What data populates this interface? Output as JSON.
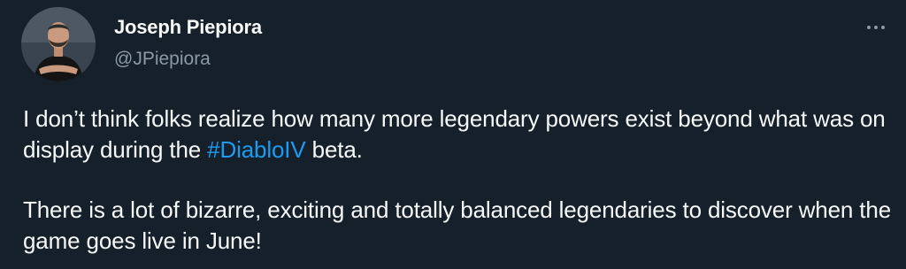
{
  "author": {
    "display_name": "Joseph Piepiora",
    "handle": "@JPiepiora",
    "avatar_icon": "user-avatar"
  },
  "menu": {
    "more_icon": "more-horizontal-icon"
  },
  "tweet": {
    "paragraph1": {
      "before_hashtag": "I don’t think folks realize how many more legendary powers exist beyond what was on display during the ",
      "hashtag": "#DiabloIV",
      "after_hashtag": " beta."
    },
    "paragraph2": "There is a lot of bizarre, exciting and totally balanced legendaries to discover when the game goes live in June!"
  },
  "colors": {
    "background": "#15202b",
    "text": "#f7f9f9",
    "secondary_text": "#8b98a5",
    "link": "#1d9bf0"
  }
}
